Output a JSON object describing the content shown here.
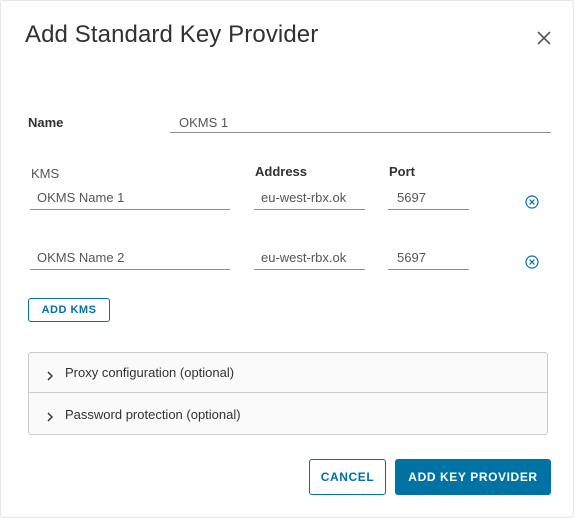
{
  "dialog": {
    "title": "Add Standard Key Provider",
    "close_icon": "close-icon"
  },
  "name_field": {
    "label": "Name",
    "value": "OKMS 1"
  },
  "kms_table": {
    "headers": {
      "kms": "KMS",
      "address": "Address",
      "port": "Port"
    },
    "rows": [
      {
        "name": "OKMS Name 1",
        "address": "eu-west-rbx.ok",
        "port": "5697",
        "remove_icon": "remove-circle-icon"
      },
      {
        "name": "OKMS Name 2",
        "address": "eu-west-rbx.ok",
        "port": "5697",
        "remove_icon": "remove-circle-icon"
      }
    ],
    "add_button": "ADD KMS"
  },
  "accordion": [
    {
      "label": "Proxy configuration (optional)",
      "icon": "chevron-right-icon"
    },
    {
      "label": "Password protection (optional)",
      "icon": "chevron-right-icon"
    }
  ],
  "footer": {
    "cancel": "CANCEL",
    "submit": "ADD KEY PROVIDER"
  },
  "colors": {
    "accent": "#0072a3",
    "text": "#313131",
    "border": "#cccccc"
  }
}
